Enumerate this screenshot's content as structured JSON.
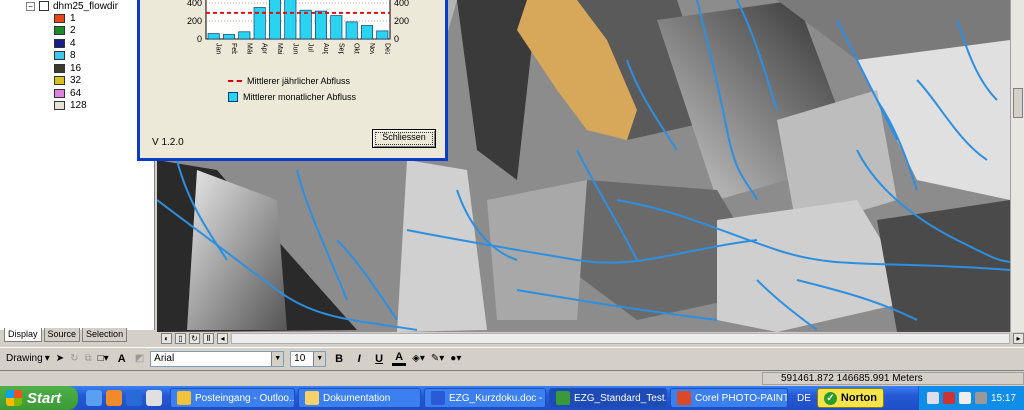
{
  "toc": {
    "layer_name": "dhm25_flowdir",
    "legend": [
      {
        "label": "1",
        "color": "#e8461e"
      },
      {
        "label": "2",
        "color": "#1e8a2a"
      },
      {
        "label": "4",
        "color": "#1a1a8a"
      },
      {
        "label": "8",
        "color": "#3ec8f0"
      },
      {
        "label": "16",
        "color": "#3a3a2a"
      },
      {
        "label": "32",
        "color": "#d8c020"
      },
      {
        "label": "64",
        "color": "#e080e0"
      },
      {
        "label": "128",
        "color": "#e6e2d8"
      }
    ],
    "tabs": [
      "Display",
      "Source",
      "Selection"
    ]
  },
  "dialog": {
    "legend_annual": "Mittlerer jährlicher Abfluss",
    "legend_monthly": "Mittlerer monatlicher Abfluss",
    "version": "V 1.2.0",
    "close_button": "Schliessen"
  },
  "chart_data": {
    "type": "bar",
    "categories": [
      "Jan",
      "Feb",
      "Mär",
      "Apr",
      "Mai",
      "Jun",
      "Jul",
      "Aug",
      "Sep",
      "Okt",
      "Nov",
      "Dez"
    ],
    "values": [
      60,
      50,
      80,
      350,
      470,
      470,
      320,
      310,
      260,
      190,
      150,
      90
    ],
    "reference_line": 290,
    "y_ticks": [
      "0",
      "200",
      "400"
    ],
    "y2_ticks": [
      "0",
      "200",
      "400"
    ],
    "ylim": [
      0,
      500
    ],
    "bar_color": "#2ad4f0",
    "line_color": "#dd1111",
    "grid": true
  },
  "drawbar": {
    "drawing_label": "Drawing",
    "font_name": "Arial",
    "font_size": "10",
    "bold": "B",
    "italic": "I",
    "underline": "U",
    "text_tool": "A"
  },
  "status": {
    "coordinates": "591461.872  146685.991 Meters"
  },
  "taskbar": {
    "start_label": "Start",
    "tasks": [
      {
        "label": "Posteingang - Outloo...",
        "icon_color": "#f2c23a"
      },
      {
        "label": "Dokumentation",
        "icon_color": "#f6d26a"
      },
      {
        "label": "EZG_Kurzdoku.doc - ...",
        "icon_color": "#2a5ad8"
      },
      {
        "label": "EZG_Standard_Test....",
        "icon_color": "#3a9a3a"
      },
      {
        "label": "Corel PHOTO-PAINT ...",
        "icon_color": "#d84a2a"
      }
    ],
    "language": "DE",
    "norton_label": "Norton",
    "clock": "15:17"
  }
}
